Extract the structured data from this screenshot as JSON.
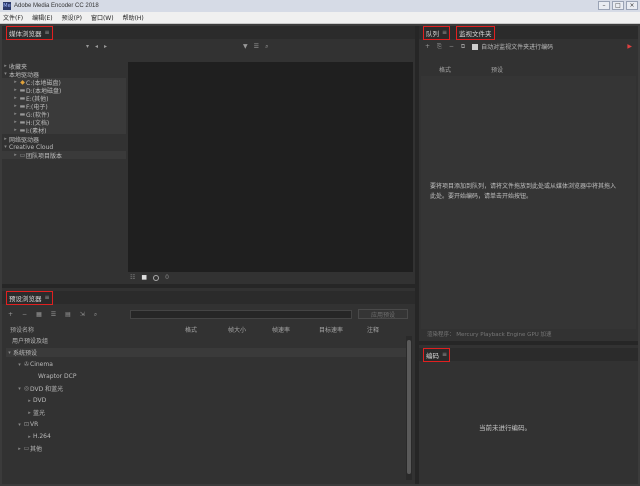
{
  "window": {
    "title": "Adobe Media Encoder CC 2018",
    "icon": "Me",
    "controls": [
      "–",
      "□",
      "×"
    ]
  },
  "menu": [
    "文件(F)",
    "编辑(E)",
    "预设(P)",
    "窗口(W)",
    "帮助(H)"
  ],
  "media_browser": {
    "tab_label": "媒体浏览器",
    "tree": [
      {
        "label": "收藏夹",
        "level": 0,
        "icon": ""
      },
      {
        "label": "本地驱动器",
        "level": 0,
        "icon": ""
      },
      {
        "label": "C:(本地磁盘)",
        "level": 1,
        "icon": "drive-icon"
      },
      {
        "label": "D:(本地磁盘)",
        "level": 1,
        "icon": "drive-icon"
      },
      {
        "label": "E:(其他)",
        "level": 1,
        "icon": "drive-icon"
      },
      {
        "label": "F:(电子)",
        "level": 1,
        "icon": "drive-icon"
      },
      {
        "label": "G:(软件)",
        "level": 1,
        "icon": "drive-icon"
      },
      {
        "label": "H:(文档)",
        "level": 1,
        "icon": "drive-icon"
      },
      {
        "label": "I:(素材)",
        "level": 1,
        "icon": "drive-icon"
      },
      {
        "label": "网络驱动器",
        "level": 0,
        "icon": ""
      },
      {
        "label": "Creative Cloud",
        "level": 0,
        "icon": ""
      },
      {
        "label": "团队项目版本",
        "level": 1,
        "icon": "cloud-folder-icon"
      }
    ],
    "preview_zoom": "0"
  },
  "preset_browser": {
    "tab_label": "预设浏览器",
    "apply_label": "应用预设",
    "columns": [
      "预设名称",
      "格式",
      "帧大小",
      "帧速率",
      "目标速率",
      "注释"
    ],
    "rows": [
      {
        "label": "用户预设及组",
        "level": 0,
        "icon": ""
      },
      {
        "label": "系统预设",
        "level": 0,
        "icon": ""
      },
      {
        "label": "Cinema",
        "level": 1,
        "icon": "cinema-icon"
      },
      {
        "label": "Wraptor DCP",
        "level": 2,
        "icon": ""
      },
      {
        "label": "DVD 和蓝光",
        "level": 1,
        "icon": "disc-icon"
      },
      {
        "label": "DVD",
        "level": 2,
        "icon": ""
      },
      {
        "label": "蓝光",
        "level": 2,
        "icon": ""
      },
      {
        "label": "VR",
        "level": 1,
        "icon": "vr-icon"
      },
      {
        "label": "H.264",
        "level": 2,
        "icon": ""
      },
      {
        "label": "其他",
        "level": 1,
        "icon": "monitor-icon"
      }
    ]
  },
  "queue": {
    "tab_label": "队列",
    "watch_tab_label": "监视文件夹",
    "auto_start_label": "自动对监视文件夹进行编码",
    "columns": [
      "格式",
      "预设"
    ],
    "empty_message": "要将项目添加到队列，请将文件拖放到此处或从媒体浏览器中将其拖入此处。要开始编码，请单击开始按钮。",
    "renderer": "渲染程序：  Mercury Playback Engine GPU 加速"
  },
  "encoding": {
    "tab_label": "编码",
    "idle_message": "当前未进行编码。"
  }
}
